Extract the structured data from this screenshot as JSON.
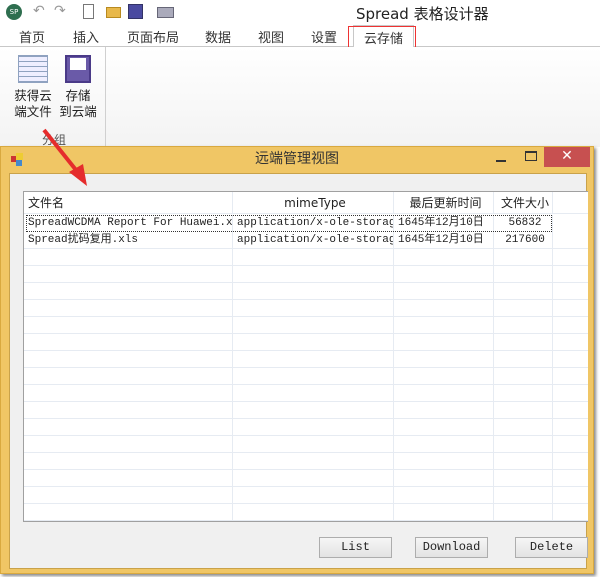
{
  "app": {
    "title": "Spread 表格设计器",
    "logo": "SP"
  },
  "qat": [
    "app-logo",
    "undo-icon",
    "redo-icon",
    "new-file-icon",
    "open-folder-icon",
    "save-icon",
    "print-icon"
  ],
  "tabs": [
    {
      "label": "首页"
    },
    {
      "label": "插入"
    },
    {
      "label": "页面布局"
    },
    {
      "label": "数据"
    },
    {
      "label": "视图"
    },
    {
      "label": "设置"
    },
    {
      "label": "云存储",
      "active": true
    }
  ],
  "ribbon": {
    "buttons": [
      {
        "line1": "获得云",
        "line2": "端文件",
        "icon": "spreadsheet-grid-icon"
      },
      {
        "line1": "存储",
        "line2": "到云端",
        "icon": "floppy-save-icon"
      }
    ],
    "group": "分组"
  },
  "dialog": {
    "title": "远端管理视图",
    "columns": [
      "文件名",
      "mimeType",
      "最后更新时间",
      "文件大小"
    ],
    "rows": [
      [
        "SpreadWCDMA Report For Huawei.xls",
        "application/x-ole-storage",
        "1645年12月10日",
        "56832"
      ],
      [
        "Spread扰码复用.xls",
        "application/x-ole-storage",
        "1645年12月10日",
        "217600"
      ]
    ],
    "buttons": {
      "list": "List",
      "download": "Download",
      "delete": "Delete"
    },
    "close": "✕"
  },
  "colors": {
    "dialog_frame": "#f0c665",
    "close_button": "#c75050",
    "highlight": "#e33333"
  }
}
